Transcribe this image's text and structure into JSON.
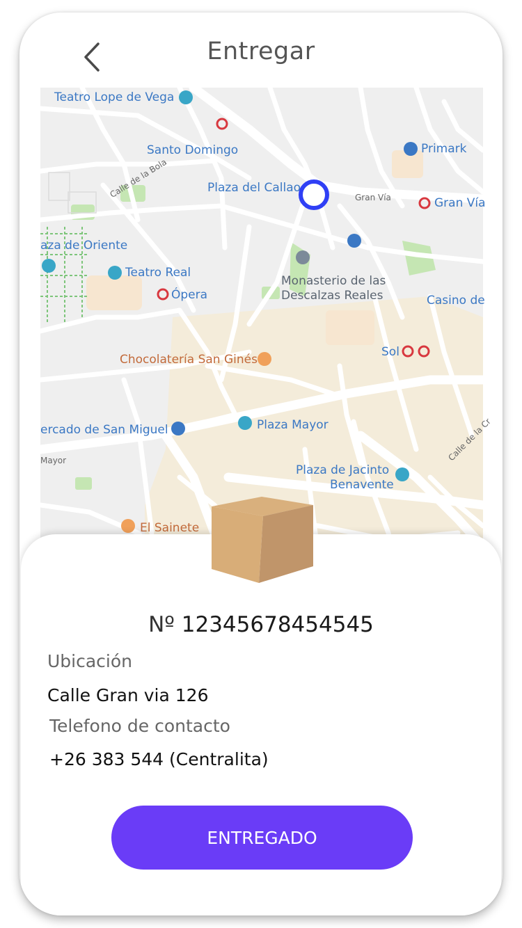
{
  "header": {
    "title": "Entregar",
    "back_icon": "chevron-left-icon"
  },
  "map": {
    "labels": {
      "teatro_lope": "Teatro Lope de Vega",
      "santo_domingo": "Santo Domingo",
      "primark": "Primark",
      "gran_via_street": "Gran Vía",
      "plaza_callao": "Plaza del Callao",
      "gran_via_metro": "Gran Vía",
      "calle_bola": "Calle de la Bola",
      "plaza_oriente": "aza de Oriente",
      "teatro_real": "Teatro Real",
      "opera": "Ópera",
      "monasterio": "Monasterio de las",
      "descalzas": "Descalzas Reales",
      "casino": "Casino de",
      "sol": "Sol",
      "chocolateria": "Chocolatería San Ginés",
      "mercado": "ercado de San Miguel",
      "plaza_mayor": "Plaza Mayor",
      "mayor_street": "Mayor",
      "plaza_jacinto": "Plaza de Jacinto",
      "benavente": "Benavente",
      "el_sainete": "El Sainete",
      "calle_cruz": "Calle de la Cr"
    },
    "colors": {
      "marker": "#2f3ff5",
      "poi_blue": "#3b78c4",
      "poi_teal": "#39a6c7",
      "metro_red": "#d8383f",
      "food_orange": "#f0a05a",
      "park_green": "#c5e6b3"
    }
  },
  "delivery": {
    "box_icon": "package-icon",
    "number_prefix": "Nº",
    "number": "12345678454545",
    "location_label": "Ubicación",
    "location_value": "Calle Gran via 126",
    "phone_label": "Telefono de contacto",
    "phone_value": "+26 383 544 (Centralita)"
  },
  "actions": {
    "deliver_label": "ENTREGADO",
    "deliver_color": "#6a3cf7"
  }
}
